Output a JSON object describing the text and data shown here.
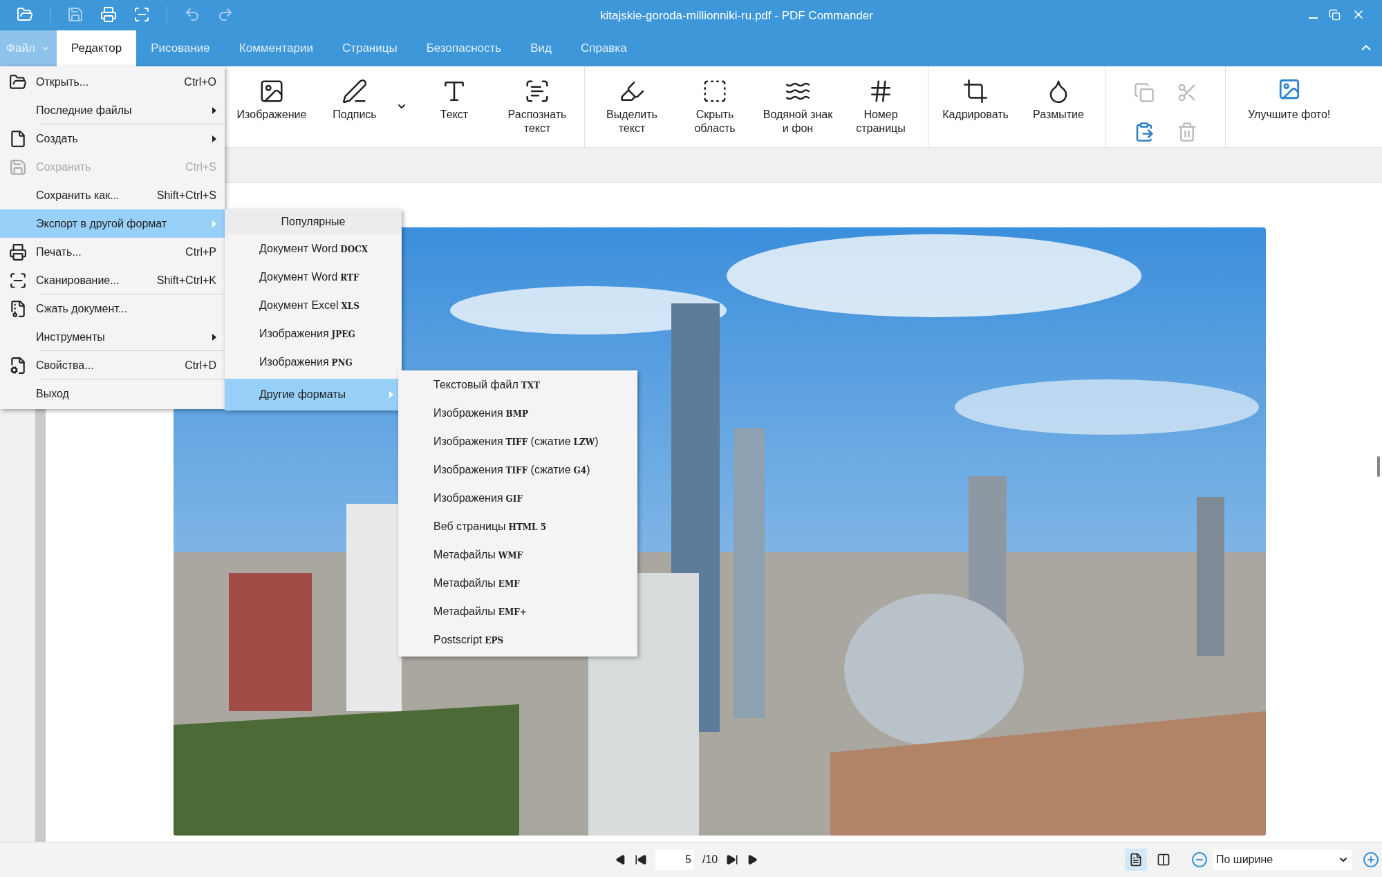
{
  "window": {
    "title": "kitajskie-goroda-millionniki-ru.pdf - PDF Commander"
  },
  "quick_access": [
    {
      "disabled": false
    },
    {
      "disabled": true
    },
    {
      "disabled": false
    },
    {
      "disabled": false
    },
    {
      "disabled": true
    },
    {
      "disabled": true
    }
  ],
  "file_button": {
    "label": "Файл",
    "open": true
  },
  "tabs": [
    {
      "label": "Редактор",
      "selected": true
    },
    {
      "label": "Рисование",
      "selected": false
    },
    {
      "label": "Комментарии",
      "selected": false
    },
    {
      "label": "Страницы",
      "selected": false
    },
    {
      "label": "Безопасность",
      "selected": false
    },
    {
      "label": "Вид",
      "selected": false
    },
    {
      "label": "Справка",
      "selected": false
    }
  ],
  "ribbon": {
    "groups": [
      {
        "items": [
          {
            "label": "Изображение",
            "dropdown": false
          },
          {
            "label": "Подпись",
            "dropdown": true
          },
          {
            "label": "Текст",
            "dropdown": false
          },
          {
            "label": "Распознать\nтекст",
            "dropdown": false
          }
        ]
      },
      {
        "items": [
          {
            "label": "Выделить\nтекст",
            "dropdown": false
          },
          {
            "label": "Скрыть\nобласть",
            "dropdown": false
          },
          {
            "label": "Водяной знак\nи фон",
            "dropdown": false
          },
          {
            "label": "Номер\nстраницы",
            "dropdown": false
          }
        ]
      },
      {
        "items": [
          {
            "label": "Кадрировать",
            "dropdown": false
          },
          {
            "label": "Размытие",
            "dropdown": false
          }
        ]
      }
    ],
    "clipboard": [
      {
        "disabled": true
      },
      {
        "disabled": true
      },
      {
        "disabled": false
      },
      {
        "disabled": true
      }
    ],
    "enhance": {
      "label": "Улучшите фото!"
    }
  },
  "file_menu": {
    "items": [
      {
        "label": "Открыть...",
        "shortcut": "Ctrl+O",
        "submenu": false,
        "disabled": false,
        "selected": false,
        "divider_after": false
      },
      {
        "label": "Последние файлы",
        "submenu": true,
        "disabled": false,
        "selected": false,
        "divider_after": true
      },
      {
        "label": "Создать",
        "submenu": true,
        "disabled": false,
        "selected": false,
        "divider_after": false
      },
      {
        "label": "Сохранить",
        "shortcut": "Ctrl+S",
        "submenu": false,
        "disabled": true,
        "selected": false,
        "divider_after": false
      },
      {
        "label": "Сохранить как...",
        "shortcut": "Shift+Ctrl+S",
        "submenu": false,
        "disabled": false,
        "selected": false,
        "divider_after": false
      },
      {
        "label": "Экспорт в другой формат",
        "submenu": true,
        "disabled": false,
        "selected": true,
        "divider_after": false
      },
      {
        "label": "Печать...",
        "shortcut": "Ctrl+P",
        "submenu": false,
        "disabled": false,
        "selected": false,
        "divider_after": false
      },
      {
        "label": "Сканирование...",
        "shortcut": "Shift+Ctrl+K",
        "submenu": false,
        "disabled": false,
        "selected": false,
        "divider_after": true
      },
      {
        "label": "Сжать документ...",
        "submenu": false,
        "disabled": false,
        "selected": false,
        "divider_after": false
      },
      {
        "label": "Инструменты",
        "submenu": true,
        "disabled": false,
        "selected": false,
        "divider_after": true
      },
      {
        "label": "Свойства...",
        "shortcut": "Ctrl+D",
        "submenu": false,
        "disabled": false,
        "selected": false,
        "divider_after": true
      },
      {
        "label": "Выход",
        "submenu": false,
        "disabled": false,
        "selected": false,
        "divider_after": false
      }
    ]
  },
  "export_menu": {
    "header": "Популярные",
    "items": [
      {
        "label": "Документ Word",
        "format": "DOCX",
        "submenu": false,
        "selected": false
      },
      {
        "label": "Документ Word",
        "format": "RTF",
        "submenu": false,
        "selected": false
      },
      {
        "label": "Документ Excel",
        "format": "XLS",
        "submenu": false,
        "selected": false
      },
      {
        "label": "Изображения",
        "format": "JPEG",
        "submenu": false,
        "selected": false
      },
      {
        "label": "Изображения",
        "format": "PNG",
        "submenu": false,
        "selected": false
      },
      {
        "label": "Другие форматы",
        "submenu": true,
        "selected": true
      }
    ]
  },
  "other_formats_menu": {
    "items": [
      {
        "label": "Текстовый файл",
        "format": "TXT"
      },
      {
        "label": "Изображения",
        "format": "BMP"
      },
      {
        "label": "Изображения",
        "format": "TIFF",
        "suffix": "(сжатие",
        "suffix_format": "LZW",
        "close": ")"
      },
      {
        "label": "Изображения",
        "format": "TIFF",
        "suffix": "(сжатие",
        "suffix_format": "G4",
        "close": ")"
      },
      {
        "label": "Изображения",
        "format": "GIF"
      },
      {
        "label": "Веб страницы",
        "format": "HTML 5"
      },
      {
        "label": "Метафайлы",
        "format": "WMF"
      },
      {
        "label": "Метафайлы",
        "format": "EMF"
      },
      {
        "label": "Метафайлы",
        "format": "EMF+"
      },
      {
        "label": "Postscript",
        "format": "EPS"
      }
    ]
  },
  "status_bar": {
    "page": "5",
    "total": "/10",
    "views": [
      {
        "selected": true
      },
      {
        "selected": false
      }
    ],
    "zoom": "По ширине"
  }
}
